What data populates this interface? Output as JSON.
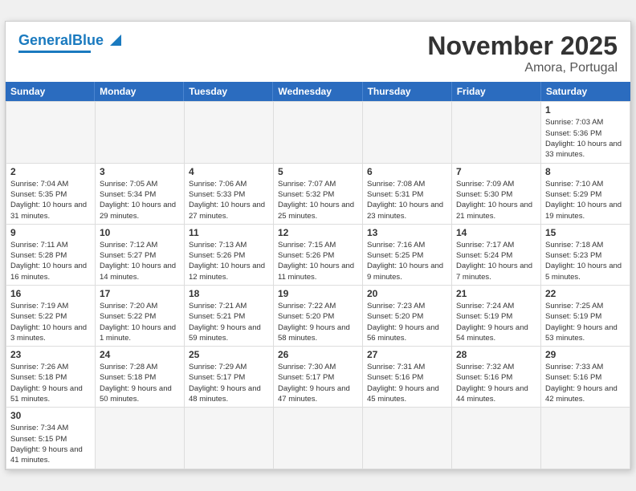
{
  "header": {
    "logo_general": "General",
    "logo_blue": "Blue",
    "month": "November 2025",
    "location": "Amora, Portugal"
  },
  "days": [
    "Sunday",
    "Monday",
    "Tuesday",
    "Wednesday",
    "Thursday",
    "Friday",
    "Saturday"
  ],
  "cells": [
    {
      "day": "",
      "empty": true
    },
    {
      "day": "",
      "empty": true
    },
    {
      "day": "",
      "empty": true
    },
    {
      "day": "",
      "empty": true
    },
    {
      "day": "",
      "empty": true
    },
    {
      "day": "",
      "empty": true
    },
    {
      "day": "1",
      "sunrise": "Sunrise: 7:03 AM",
      "sunset": "Sunset: 5:36 PM",
      "daylight": "Daylight: 10 hours and 33 minutes."
    }
  ],
  "week2": [
    {
      "day": "2",
      "sunrise": "Sunrise: 7:04 AM",
      "sunset": "Sunset: 5:35 PM",
      "daylight": "Daylight: 10 hours and 31 minutes."
    },
    {
      "day": "3",
      "sunrise": "Sunrise: 7:05 AM",
      "sunset": "Sunset: 5:34 PM",
      "daylight": "Daylight: 10 hours and 29 minutes."
    },
    {
      "day": "4",
      "sunrise": "Sunrise: 7:06 AM",
      "sunset": "Sunset: 5:33 PM",
      "daylight": "Daylight: 10 hours and 27 minutes."
    },
    {
      "day": "5",
      "sunrise": "Sunrise: 7:07 AM",
      "sunset": "Sunset: 5:32 PM",
      "daylight": "Daylight: 10 hours and 25 minutes."
    },
    {
      "day": "6",
      "sunrise": "Sunrise: 7:08 AM",
      "sunset": "Sunset: 5:31 PM",
      "daylight": "Daylight: 10 hours and 23 minutes."
    },
    {
      "day": "7",
      "sunrise": "Sunrise: 7:09 AM",
      "sunset": "Sunset: 5:30 PM",
      "daylight": "Daylight: 10 hours and 21 minutes."
    },
    {
      "day": "8",
      "sunrise": "Sunrise: 7:10 AM",
      "sunset": "Sunset: 5:29 PM",
      "daylight": "Daylight: 10 hours and 19 minutes."
    }
  ],
  "week3": [
    {
      "day": "9",
      "sunrise": "Sunrise: 7:11 AM",
      "sunset": "Sunset: 5:28 PM",
      "daylight": "Daylight: 10 hours and 16 minutes."
    },
    {
      "day": "10",
      "sunrise": "Sunrise: 7:12 AM",
      "sunset": "Sunset: 5:27 PM",
      "daylight": "Daylight: 10 hours and 14 minutes."
    },
    {
      "day": "11",
      "sunrise": "Sunrise: 7:13 AM",
      "sunset": "Sunset: 5:26 PM",
      "daylight": "Daylight: 10 hours and 12 minutes."
    },
    {
      "day": "12",
      "sunrise": "Sunrise: 7:15 AM",
      "sunset": "Sunset: 5:26 PM",
      "daylight": "Daylight: 10 hours and 11 minutes."
    },
    {
      "day": "13",
      "sunrise": "Sunrise: 7:16 AM",
      "sunset": "Sunset: 5:25 PM",
      "daylight": "Daylight: 10 hours and 9 minutes."
    },
    {
      "day": "14",
      "sunrise": "Sunrise: 7:17 AM",
      "sunset": "Sunset: 5:24 PM",
      "daylight": "Daylight: 10 hours and 7 minutes."
    },
    {
      "day": "15",
      "sunrise": "Sunrise: 7:18 AM",
      "sunset": "Sunset: 5:23 PM",
      "daylight": "Daylight: 10 hours and 5 minutes."
    }
  ],
  "week4": [
    {
      "day": "16",
      "sunrise": "Sunrise: 7:19 AM",
      "sunset": "Sunset: 5:22 PM",
      "daylight": "Daylight: 10 hours and 3 minutes."
    },
    {
      "day": "17",
      "sunrise": "Sunrise: 7:20 AM",
      "sunset": "Sunset: 5:22 PM",
      "daylight": "Daylight: 10 hours and 1 minute."
    },
    {
      "day": "18",
      "sunrise": "Sunrise: 7:21 AM",
      "sunset": "Sunset: 5:21 PM",
      "daylight": "Daylight: 9 hours and 59 minutes."
    },
    {
      "day": "19",
      "sunrise": "Sunrise: 7:22 AM",
      "sunset": "Sunset: 5:20 PM",
      "daylight": "Daylight: 9 hours and 58 minutes."
    },
    {
      "day": "20",
      "sunrise": "Sunrise: 7:23 AM",
      "sunset": "Sunset: 5:20 PM",
      "daylight": "Daylight: 9 hours and 56 minutes."
    },
    {
      "day": "21",
      "sunrise": "Sunrise: 7:24 AM",
      "sunset": "Sunset: 5:19 PM",
      "daylight": "Daylight: 9 hours and 54 minutes."
    },
    {
      "day": "22",
      "sunrise": "Sunrise: 7:25 AM",
      "sunset": "Sunset: 5:19 PM",
      "daylight": "Daylight: 9 hours and 53 minutes."
    }
  ],
  "week5": [
    {
      "day": "23",
      "sunrise": "Sunrise: 7:26 AM",
      "sunset": "Sunset: 5:18 PM",
      "daylight": "Daylight: 9 hours and 51 minutes."
    },
    {
      "day": "24",
      "sunrise": "Sunrise: 7:28 AM",
      "sunset": "Sunset: 5:18 PM",
      "daylight": "Daylight: 9 hours and 50 minutes."
    },
    {
      "day": "25",
      "sunrise": "Sunrise: 7:29 AM",
      "sunset": "Sunset: 5:17 PM",
      "daylight": "Daylight: 9 hours and 48 minutes."
    },
    {
      "day": "26",
      "sunrise": "Sunrise: 7:30 AM",
      "sunset": "Sunset: 5:17 PM",
      "daylight": "Daylight: 9 hours and 47 minutes."
    },
    {
      "day": "27",
      "sunrise": "Sunrise: 7:31 AM",
      "sunset": "Sunset: 5:16 PM",
      "daylight": "Daylight: 9 hours and 45 minutes."
    },
    {
      "day": "28",
      "sunrise": "Sunrise: 7:32 AM",
      "sunset": "Sunset: 5:16 PM",
      "daylight": "Daylight: 9 hours and 44 minutes."
    },
    {
      "day": "29",
      "sunrise": "Sunrise: 7:33 AM",
      "sunset": "Sunset: 5:16 PM",
      "daylight": "Daylight: 9 hours and 42 minutes."
    }
  ],
  "week6": [
    {
      "day": "30",
      "sunrise": "Sunrise: 7:34 AM",
      "sunset": "Sunset: 5:15 PM",
      "daylight": "Daylight: 9 hours and 41 minutes."
    },
    {
      "day": "",
      "empty": true
    },
    {
      "day": "",
      "empty": true
    },
    {
      "day": "",
      "empty": true
    },
    {
      "day": "",
      "empty": true
    },
    {
      "day": "",
      "empty": true
    },
    {
      "day": "",
      "empty": true
    }
  ]
}
